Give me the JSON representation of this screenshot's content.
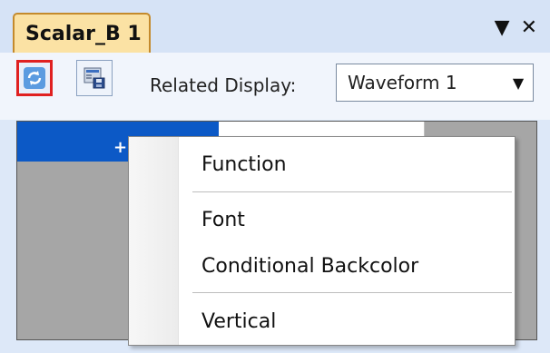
{
  "window": {
    "tab_title": "Scalar_B 1",
    "pin_icon": "▼",
    "close_icon": "✕"
  },
  "toolbar": {
    "refresh_icon": "refresh-icon",
    "save_icon": "save-display-icon",
    "related_display_label": "Related Display:",
    "related_display_value": "Waveform 1"
  },
  "display": {
    "header_plus": "+"
  },
  "context_menu": {
    "items": [
      {
        "label": "Function"
      },
      {
        "label": "Font"
      },
      {
        "label": "Conditional Backcolor"
      },
      {
        "label": "Vertical"
      }
    ]
  }
}
